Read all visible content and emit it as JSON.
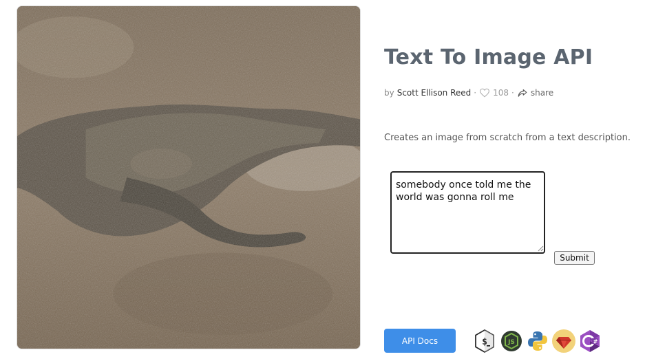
{
  "hero_image": {
    "alt": "komodo dragon image"
  },
  "page": {
    "title": "Text To Image API"
  },
  "meta": {
    "by_label": "by",
    "author": "Scott Ellison Reed",
    "separator": "·",
    "likes": "108",
    "share_label": "share"
  },
  "description": "Creates an image from scratch from a text description.",
  "form": {
    "prompt_value": "somebody once told me the world was gonna roll me",
    "submit_label": "Submit"
  },
  "api_docs_label": "API Docs",
  "language_icons": [
    "bash-icon",
    "nodejs-icon",
    "python-icon",
    "ruby-icon",
    "csharp-icon"
  ],
  "colors": {
    "accent": "#3e8ee8",
    "title": "#5b6570"
  }
}
